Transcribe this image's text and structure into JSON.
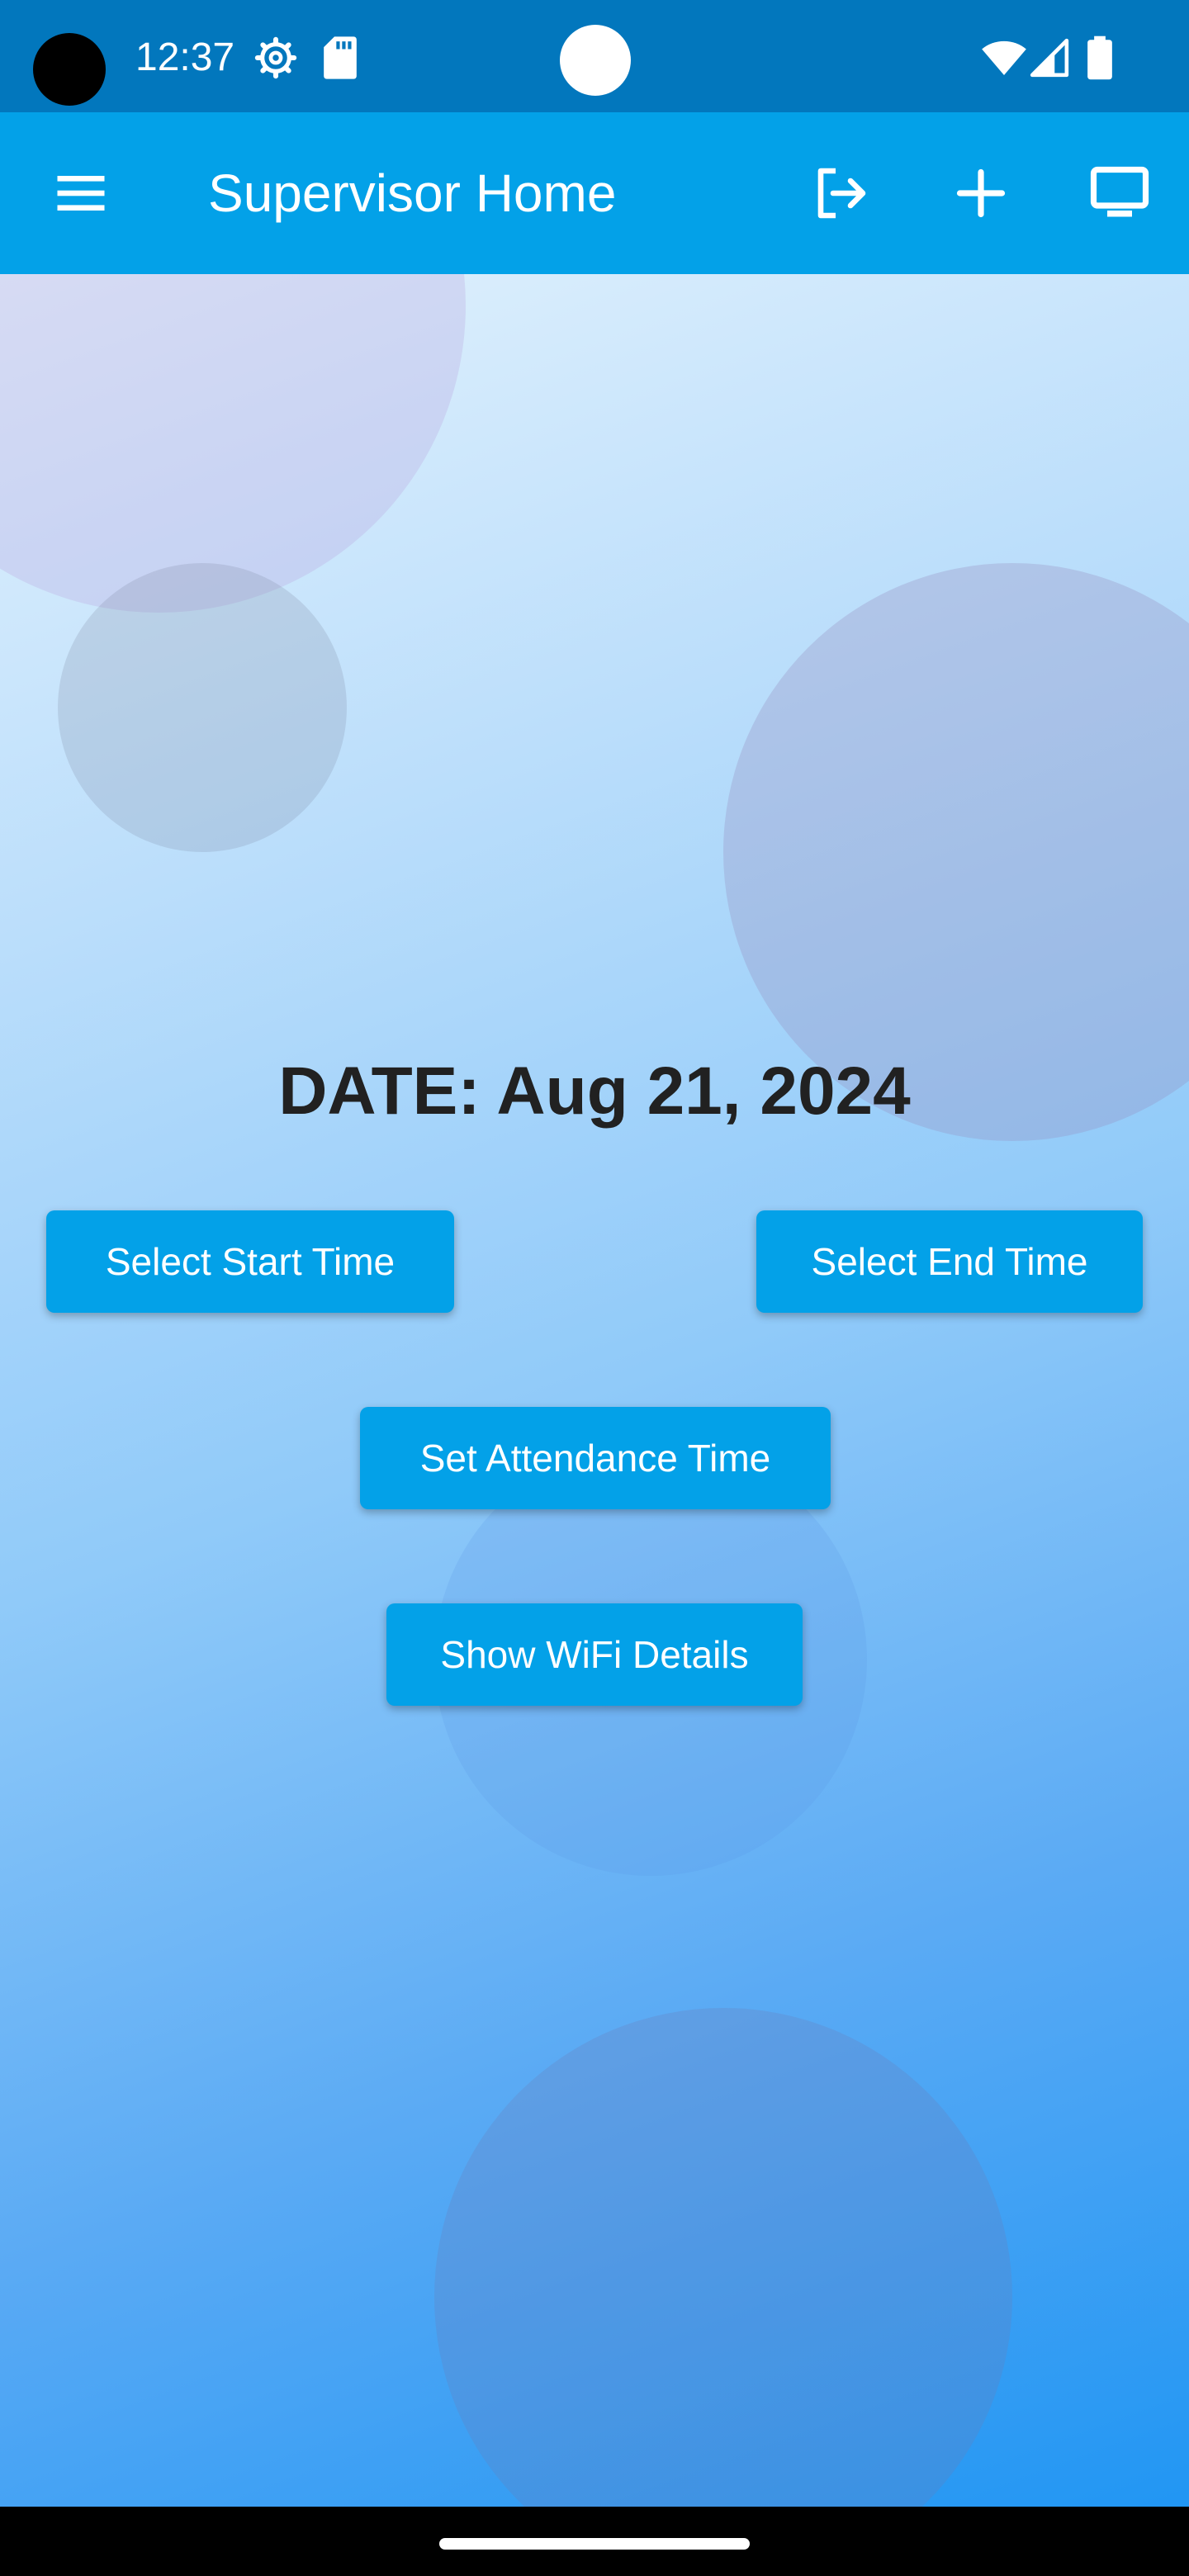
{
  "status_bar": {
    "time": "12:37",
    "icons": [
      "settings-gear-icon",
      "sd-card-icon",
      "wifi-icon",
      "cell-signal-icon",
      "battery-icon"
    ]
  },
  "app_bar": {
    "title": "Supervisor Home",
    "icons": [
      "menu-icon",
      "logout-icon",
      "add-icon",
      "monitor-icon"
    ]
  },
  "main": {
    "date_label": "DATE: Aug 21, 2024",
    "buttons": {
      "select_start_time": "Select Start Time",
      "select_end_time": "Select End Time",
      "set_attendance_time": "Set Attendance Time",
      "show_wifi_details": "Show WiFi Details"
    }
  },
  "colors": {
    "status_bar": "#0277bd",
    "app_bar": "#03a1e8",
    "button": "#03a1e8",
    "date_text": "#212121"
  }
}
